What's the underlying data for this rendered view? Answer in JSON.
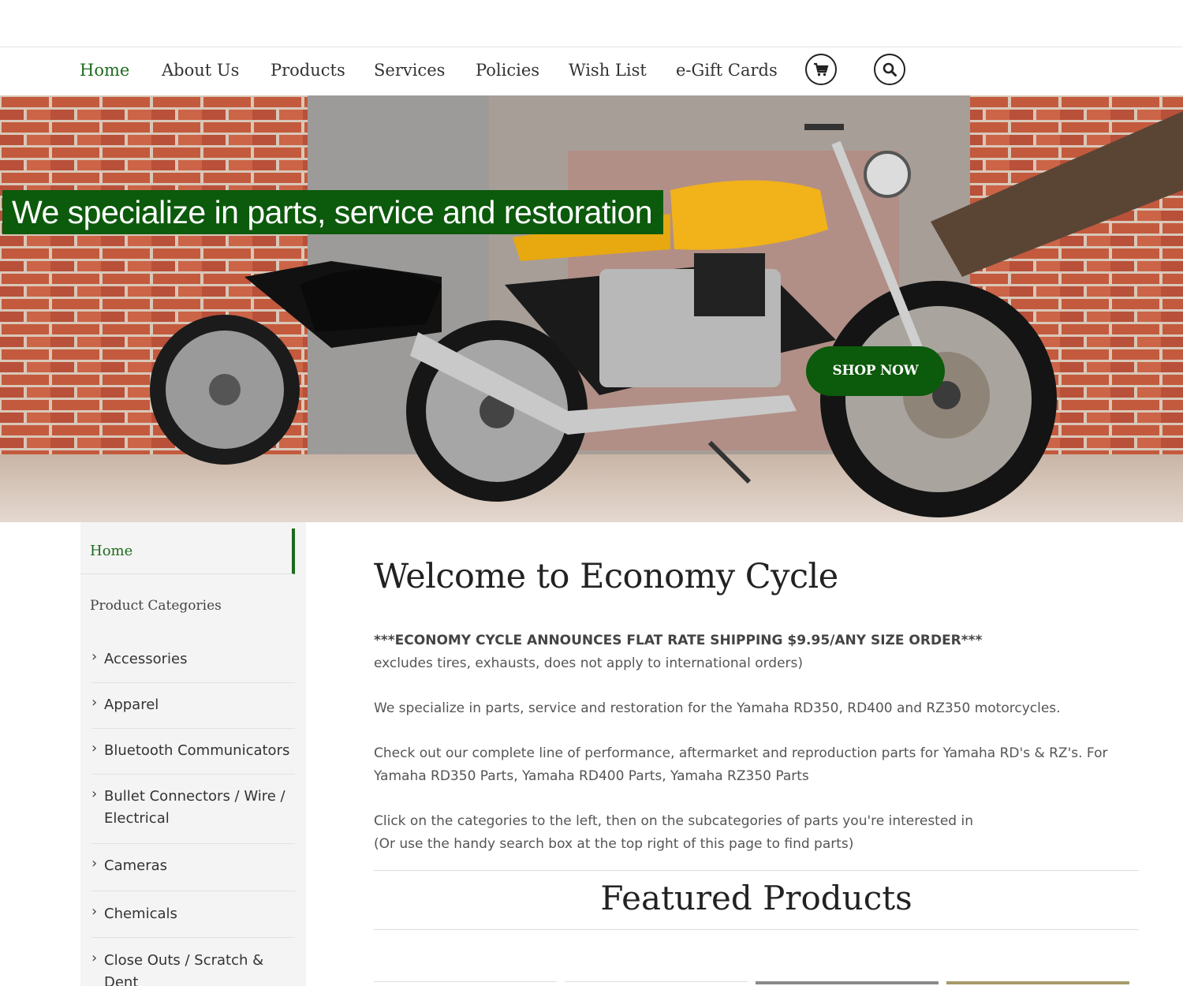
{
  "nav": {
    "items": [
      {
        "label": "Home",
        "active": true
      },
      {
        "label": "About Us"
      },
      {
        "label": "Products"
      },
      {
        "label": "Services"
      },
      {
        "label": "Policies"
      },
      {
        "label": "Wish List"
      },
      {
        "label": "e-Gift Cards"
      }
    ],
    "icons": [
      "cart-icon",
      "search-icon"
    ],
    "accent": "#1e6b1e"
  },
  "hero": {
    "headline": "We specialize in parts, service and restoration",
    "cta_label": "SHOP NOW",
    "banner_color": "#0c5a0c"
  },
  "sidebar": {
    "home_label": "Home",
    "categories_title": "Product Categories",
    "items": [
      "Accessories",
      "Apparel",
      "Bluetooth Communicators",
      "Bullet Connectors / Wire / Electrical",
      "Cameras",
      "Chemicals",
      "Close Outs / Scratch & Dent"
    ]
  },
  "main": {
    "title": "Welcome to Economy Cycle",
    "announcement": "***ECONOMY CYCLE ANNOUNCES FLAT RATE SHIPPING $9.95/ANY SIZE ORDER***",
    "announcement_note": "excludes tires, exhausts, does not apply to international orders)",
    "para1": "We specialize in parts, service and restoration for the Yamaha RD350, RD400 and RZ350 motorcycles.",
    "para2_line1": "Check out our complete line of performance, aftermarket and reproduction parts for Yamaha RD's & RZ's. For",
    "para2_line2": "Yamaha RD350 Parts, Yamaha RD400 Parts, Yamaha RZ350 Parts",
    "para3_line1": "Click on the categories to the left, then on the subcategories of parts you're interested in",
    "para3_line2": "(Or use the handy search box at the top right of this page to find parts)",
    "featured_title": "Featured Products"
  }
}
